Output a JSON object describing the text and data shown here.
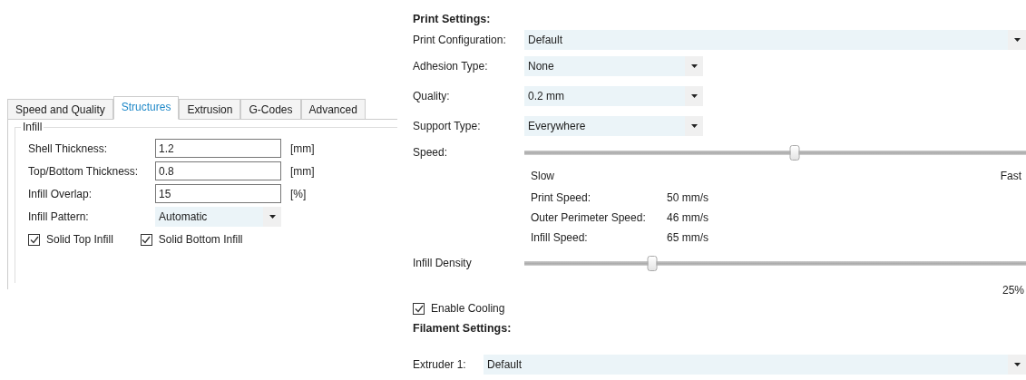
{
  "left_panel": {
    "tabs": [
      {
        "label": "Speed and Quality",
        "selected": false
      },
      {
        "label": "Structures",
        "selected": true
      },
      {
        "label": "Extrusion",
        "selected": false
      },
      {
        "label": "G-Codes",
        "selected": false
      },
      {
        "label": "Advanced",
        "selected": false
      }
    ],
    "group": {
      "title": "Infill",
      "fields": [
        {
          "kind": "text",
          "label": "Shell Thickness:",
          "value": "1.2",
          "unit": "[mm]"
        },
        {
          "kind": "text",
          "label": "Top/Bottom Thickness:",
          "value": "0.8",
          "unit": "[mm]"
        },
        {
          "kind": "text",
          "label": "Infill Overlap:",
          "value": "15",
          "unit": "[%]"
        },
        {
          "kind": "dropdown",
          "label": "Infill Pattern:",
          "value": "Automatic"
        }
      ],
      "checkboxes": [
        {
          "label": "Solid Top Infill",
          "checked": true
        },
        {
          "label": "Solid Bottom Infill",
          "checked": true
        }
      ]
    }
  },
  "print_settings": {
    "title": "Print Settings:",
    "configuration": {
      "label": "Print Configuration:",
      "value": "Default"
    },
    "dropdowns": [
      {
        "label": "Adhesion Type:",
        "value": "None"
      },
      {
        "label": "Quality:",
        "value": "0.2 mm"
      },
      {
        "label": "Support Type:",
        "value": "Everywhere"
      }
    ],
    "speed": {
      "label": "Speed:",
      "level": 0.54,
      "min_label": "Slow",
      "max_label": "Fast",
      "details": [
        {
          "label": "Print Speed:",
          "value": "50 mm/s"
        },
        {
          "label": "Outer Perimeter Speed:",
          "value": "46 mm/s"
        },
        {
          "label": "Infill Speed:",
          "value": "65 mm/s"
        }
      ]
    },
    "infill_density": {
      "label": "Infill Density",
      "level": 0.25,
      "reading": "25%"
    },
    "cooling": {
      "label": "Enable Cooling",
      "checked": true
    }
  },
  "filament_settings": {
    "title": "Filament Settings:",
    "extruder": {
      "label": "Extruder 1:",
      "value": "Default"
    }
  }
}
